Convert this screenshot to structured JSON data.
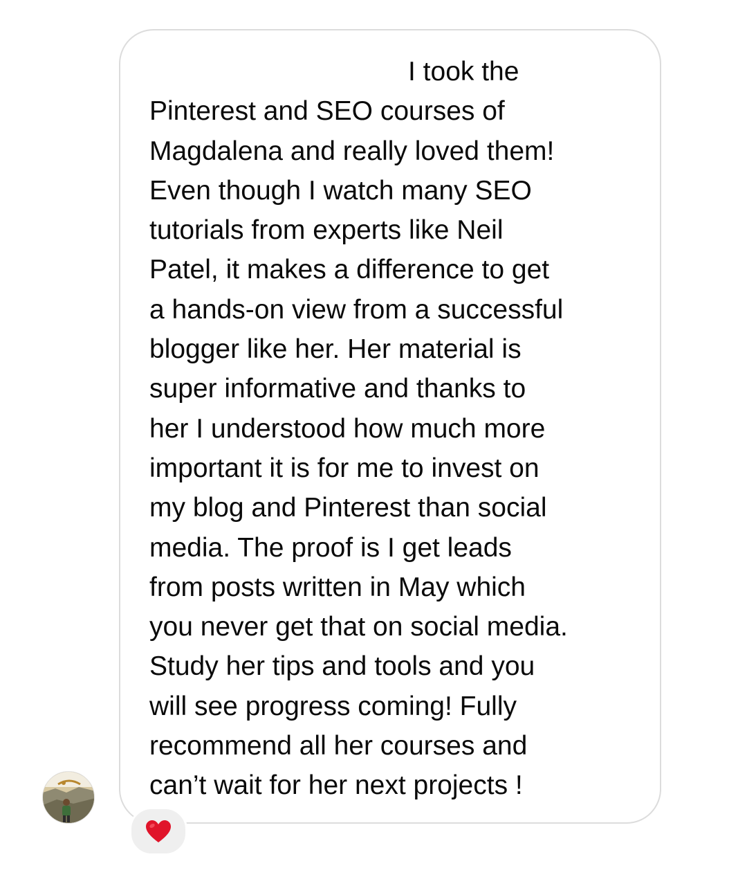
{
  "message": {
    "lines": [
      "I took the",
      "Pinterest and SEO courses of",
      "Magdalena and really loved them!",
      "Even though I watch many SEO",
      "tutorials from experts like Neil",
      "Patel, it makes a difference to get",
      "a hands-on view from a successful",
      "blogger like her. Her material is",
      "super informative and thanks to",
      "her I understood how much more",
      "important it is for me to invest on",
      "my blog and Pinterest than social",
      "media. The proof is I get leads",
      "from posts written in May which",
      "you never get that on social media.",
      "Study her tips and tools and you",
      "will see progress coming! Fully",
      "recommend all her courses and",
      "can’t wait for her next projects !"
    ]
  },
  "sender": {
    "avatar_icon": "profile-photo"
  },
  "reaction": {
    "icon": "red-heart-icon",
    "color": "#e0142a"
  },
  "colors": {
    "bubble_border": "#dcdcdc",
    "text": "#0a0a0a",
    "reaction_background": "#efefef"
  }
}
